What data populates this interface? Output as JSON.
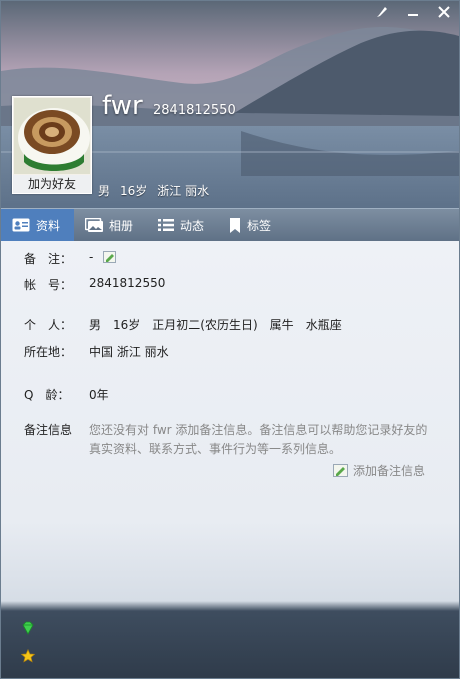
{
  "window": {
    "controls": [
      "skin",
      "minimize",
      "close"
    ]
  },
  "profile": {
    "nickname": "fwr",
    "qq_number": "2841812550",
    "add_friend_label": "加为好友",
    "gender": "男",
    "age": "16岁",
    "location": "浙江 丽水"
  },
  "tabs": [
    {
      "label": "资料",
      "icon": "profile-card-icon",
      "active": true
    },
    {
      "label": "相册",
      "icon": "photo-album-icon",
      "active": false
    },
    {
      "label": "动态",
      "icon": "feed-list-icon",
      "active": false
    },
    {
      "label": "标签",
      "icon": "bookmark-icon",
      "active": false
    }
  ],
  "details": {
    "remark_label": "备　注：",
    "remark_value": "-",
    "account_label": "帐　号：",
    "account_value": "2841812550",
    "personal_label": "个　人：",
    "personal_gender": "男",
    "personal_age": "16岁",
    "personal_birthday": "正月初二(农历生日)",
    "personal_zodiac": "属牛",
    "personal_constellation": "水瓶座",
    "location_label": "所在地：",
    "location_value": "中国 浙江 丽水",
    "qage_label": "Q　龄：",
    "qage_value": "0年",
    "note_label": "备注信息",
    "note_text": "您还没有对 fwr 添加备注信息。备注信息可以帮助您记录好友的真实资料、联系方式、事件行为等一系列信息。",
    "add_note_label": "添加备注信息"
  },
  "colors": {
    "tab_active": "#4f7fbd",
    "tab_bar": "#6e8095"
  }
}
